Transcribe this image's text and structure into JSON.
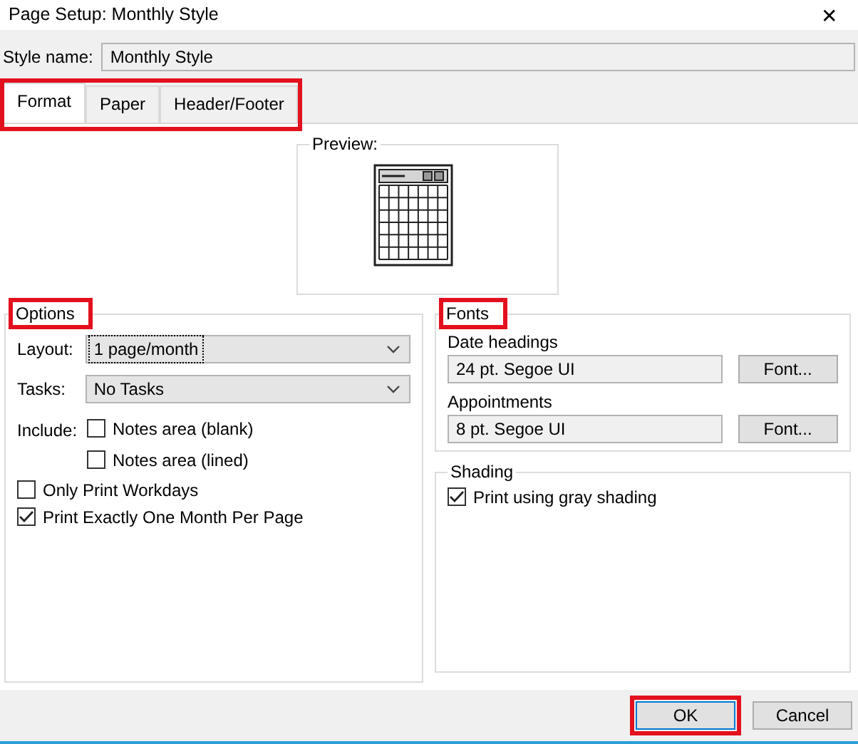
{
  "window": {
    "title": "Page Setup: Monthly Style",
    "close": "✕"
  },
  "style_name": {
    "label": "Style name:",
    "value": "Monthly Style"
  },
  "tabs_highlighted": true,
  "tabs": [
    {
      "label": "Format",
      "selected": true
    },
    {
      "label": "Paper",
      "selected": false
    },
    {
      "label": "Header/Footer",
      "selected": false
    }
  ],
  "preview": {
    "label": "Preview:"
  },
  "options": {
    "label": "Options",
    "highlighted": true,
    "dropdowns": [
      {
        "label": "Layout:",
        "value": "1 page/month",
        "focused": true
      },
      {
        "label": "Tasks:",
        "value": "No Tasks",
        "focused": false
      }
    ],
    "include_label": "Include:",
    "include": [
      {
        "label": "Notes area (blank)",
        "checked": false
      },
      {
        "label": "Notes area (lined)",
        "checked": false
      }
    ],
    "checks": [
      {
        "label": "Only Print Workdays",
        "checked": false
      },
      {
        "label": "Print Exactly One Month Per Page",
        "checked": true
      }
    ]
  },
  "fonts": {
    "label": "Fonts",
    "highlighted": true,
    "items": [
      {
        "label": "Date headings",
        "value": "24 pt. Segoe UI",
        "button": "Font..."
      },
      {
        "label": "Appointments",
        "value": "8 pt. Segoe UI",
        "button": "Font..."
      }
    ]
  },
  "shading": {
    "label": "Shading",
    "checks": [
      {
        "label": "Print using gray shading",
        "checked": true
      }
    ]
  },
  "buttons": [
    {
      "label": "OK",
      "highlighted": true,
      "default": true
    },
    {
      "label": "Cancel",
      "highlighted": false,
      "default": false
    }
  ]
}
